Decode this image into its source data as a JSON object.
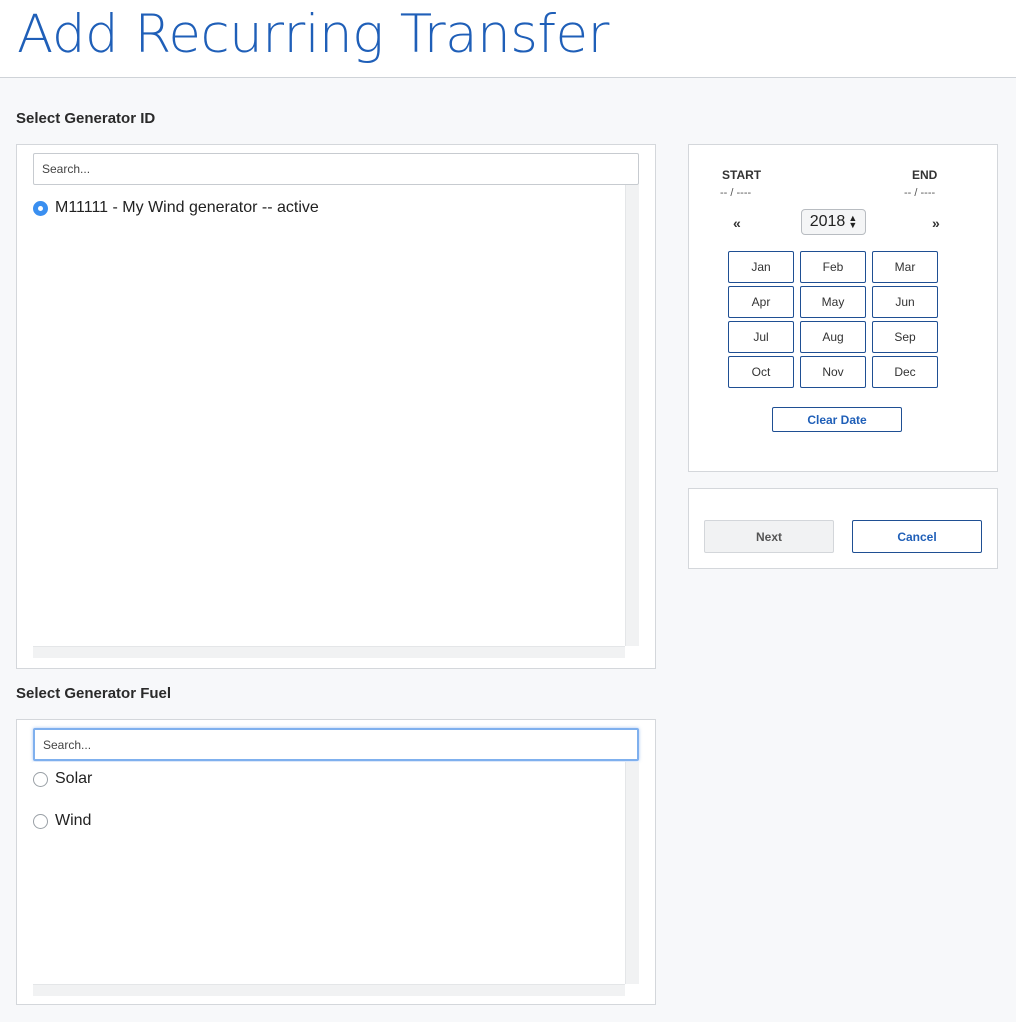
{
  "page": {
    "title": "Add Recurring Transfer"
  },
  "generator_id": {
    "label": "Select Generator ID",
    "search_placeholder": "Search...",
    "options": [
      {
        "label": "M11111 - My Wind generator -- active",
        "checked": true
      }
    ]
  },
  "generator_fuel": {
    "label": "Select Generator Fuel",
    "search_placeholder": "Search...",
    "options": [
      {
        "label": "Solar",
        "checked": false
      },
      {
        "label": "Wind",
        "checked": false
      }
    ]
  },
  "date_picker": {
    "start_label": "START",
    "start_value": "-- / ----",
    "end_label": "END",
    "end_value": "-- / ----",
    "prev_icon": "«",
    "next_icon": "»",
    "year": "2018",
    "months": [
      "Jan",
      "Feb",
      "Mar",
      "Apr",
      "May",
      "Jun",
      "Jul",
      "Aug",
      "Sep",
      "Oct",
      "Nov",
      "Dec"
    ],
    "clear_label": "Clear Date"
  },
  "actions": {
    "next_label": "Next",
    "cancel_label": "Cancel"
  },
  "colors": {
    "accent": "#1f5fb8",
    "radio_checked": "#3a8ff0",
    "button_border": "#1f4f93"
  }
}
